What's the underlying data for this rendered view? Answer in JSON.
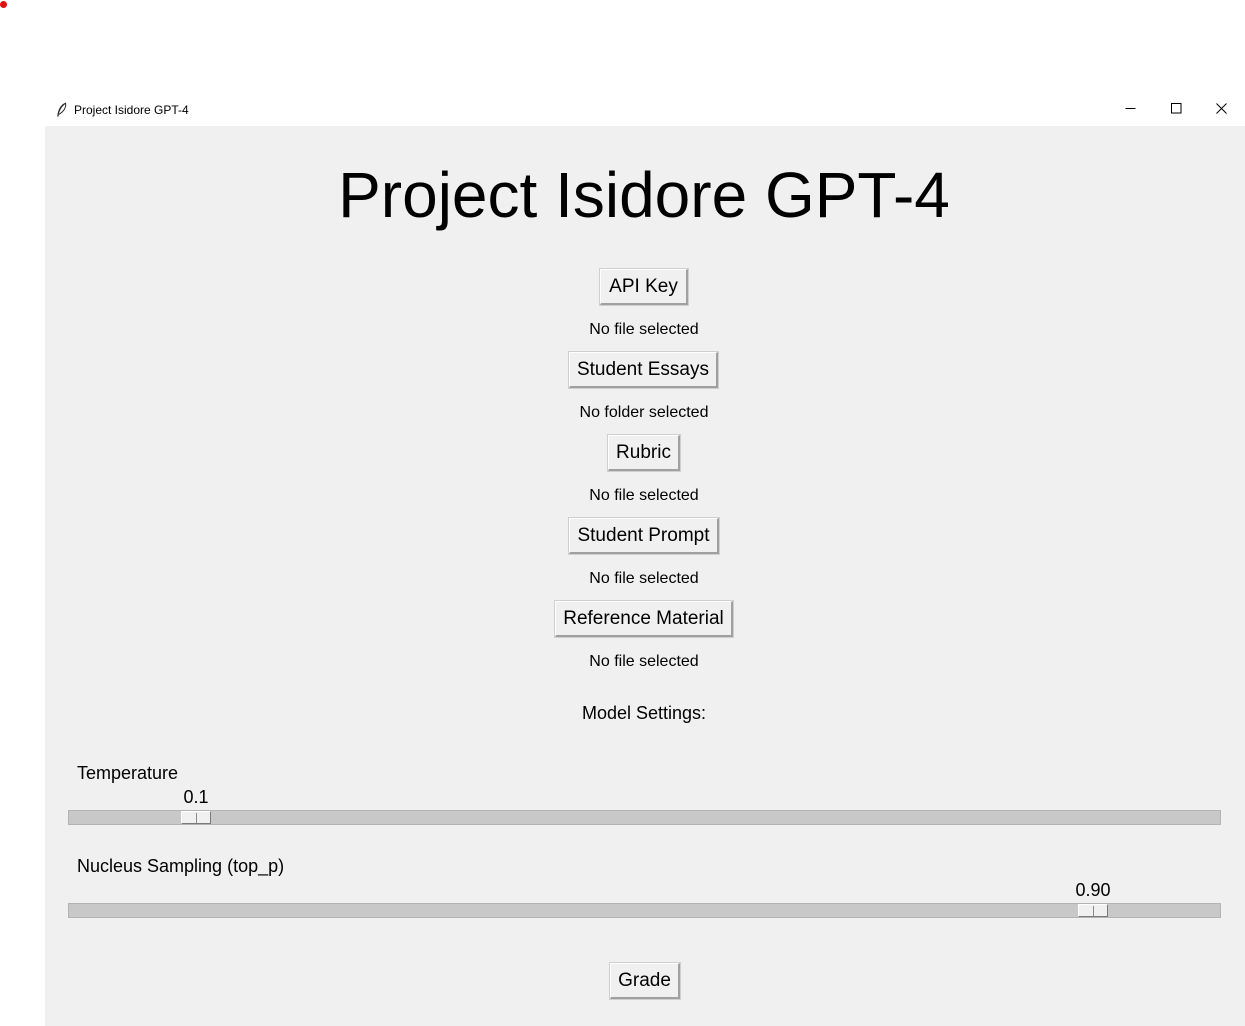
{
  "window": {
    "title": "Project Isidore GPT-4",
    "accent_dot_color": "#e01010"
  },
  "main": {
    "heading": "Project Isidore GPT-4",
    "api_key_button": "API Key",
    "api_key_status": "No file selected",
    "essays_button": "Student Essays",
    "essays_status": "No folder selected",
    "rubric_button": "Rubric",
    "rubric_status": "No file selected",
    "prompt_button": "Student Prompt",
    "prompt_status": "No file selected",
    "reference_button": "Reference Material",
    "reference_status": "No file selected",
    "model_settings_label": "Model Settings:"
  },
  "settings": {
    "temperature": {
      "label": "Temperature",
      "value": "0.1",
      "min": 0,
      "max": 1
    },
    "top_p": {
      "label": "Nucleus Sampling (top_p)",
      "value": "0.90",
      "min": 0,
      "max": 1
    }
  },
  "actions": {
    "grade_button": "Grade"
  },
  "icons": {
    "app": "feather-icon",
    "minimize": "minimize-icon",
    "maximize": "maximize-icon",
    "close": "close-icon"
  }
}
